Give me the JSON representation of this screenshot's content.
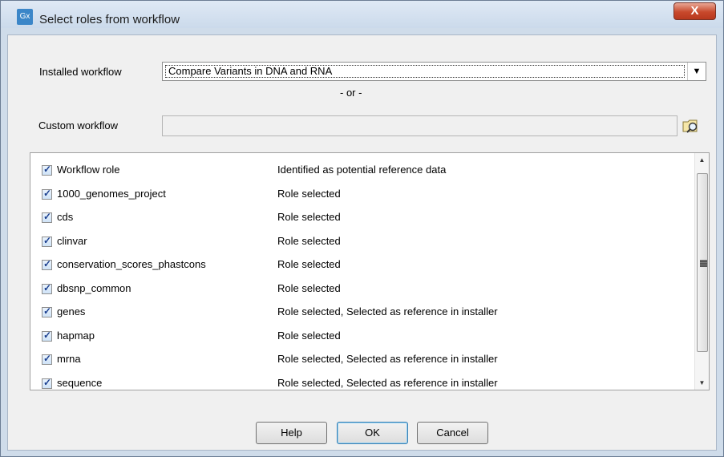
{
  "window": {
    "app_icon_text": "Gx",
    "title": "Select roles from workflow",
    "close_label": "X"
  },
  "installed_workflow": {
    "label": "Installed workflow",
    "selected": "Compare Variants in DNA and RNA"
  },
  "separator": "- or -",
  "custom_workflow": {
    "label": "Custom workflow",
    "value": ""
  },
  "roles": [
    {
      "name": "Workflow role",
      "status": "Identified as potential reference data",
      "checked": true
    },
    {
      "name": "1000_genomes_project",
      "status": "Role selected",
      "checked": true
    },
    {
      "name": "cds",
      "status": "Role selected",
      "checked": true
    },
    {
      "name": "clinvar",
      "status": "Role selected",
      "checked": true
    },
    {
      "name": "conservation_scores_phastcons",
      "status": "Role selected",
      "checked": true
    },
    {
      "name": "dbsnp_common",
      "status": "Role selected",
      "checked": true
    },
    {
      "name": "genes",
      "status": "Role selected, Selected as reference in installer",
      "checked": true
    },
    {
      "name": "hapmap",
      "status": "Role selected",
      "checked": true
    },
    {
      "name": "mrna",
      "status": "Role selected, Selected as reference in installer",
      "checked": true
    },
    {
      "name": "sequence",
      "status": "Role selected, Selected as reference in installer",
      "checked": true
    }
  ],
  "buttons": {
    "help": "Help",
    "ok": "OK",
    "cancel": "Cancel"
  }
}
